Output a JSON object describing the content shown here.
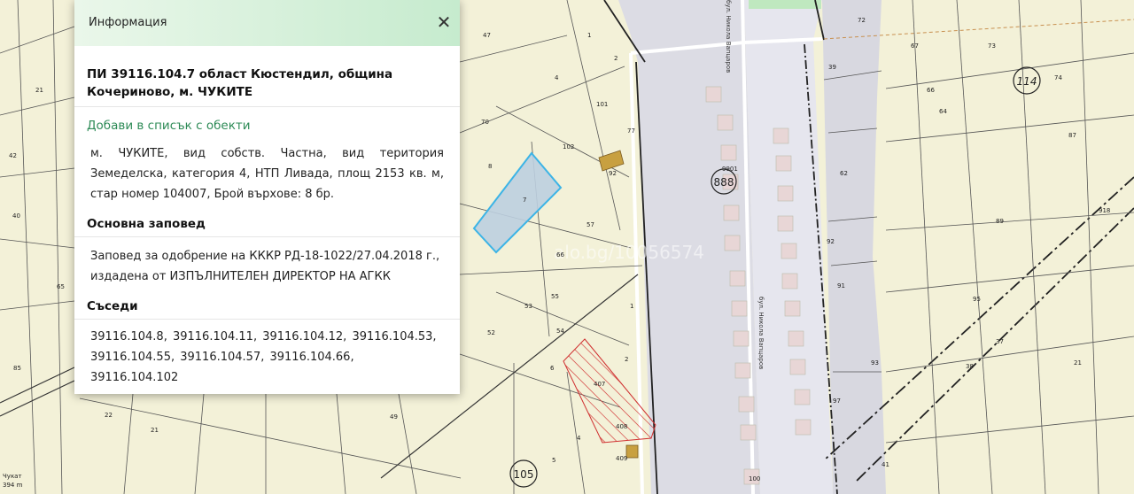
{
  "panel": {
    "title": "Информация",
    "close_symbol": "✕",
    "parcel_heading": "ПИ 39116.104.7 област Кюстендил, община Кочериново, м. ЧУКИТЕ",
    "add_link": "Добави в списък с обекти",
    "description": "м. ЧУКИТЕ, вид собств. Частна, вид територия Земеделска, категория 4, НТП Ливада, площ 2153 кв. м, стар номер 104007, Брой върхове: 8 бр.",
    "order_heading": "Основна заповед",
    "order_text_line1": "Заповед за одобрение на КККР РД-18-1022/27.04.2018 г.,",
    "order_text_line2": "издадена от ИЗПЪЛНИТЕЛЕН ДИРЕКТОР НА АГКК",
    "neighbors_heading": "Съседи",
    "neighbors_line1": "39116.104.8,  39116.104.11,  39116.104.12,  39116.104.53,",
    "neighbors_line2": "39116.104.55, 39116.104.57, 39116.104.66, 39116.104.102"
  },
  "map": {
    "watermark": "alo.bg/10056574",
    "street_name_1": "бул. Никола Вапцаров",
    "street_name_2": "бул. Никола Вапцаров",
    "circle_labels": [
      "888",
      "114",
      "105"
    ],
    "peak_label": "Чукат",
    "peak_elevation": "394 m",
    "plot_numbers": {
      "selected": "7",
      "p47": "47",
      "p1": "1",
      "p2": "2",
      "p4": "4",
      "p70": "70",
      "p101": "101",
      "p77": "77",
      "p102": "102",
      "p92": "92",
      "p8": "8",
      "p57": "57",
      "p66": "66",
      "p55": "55",
      "p53": "53",
      "p54": "54",
      "p52": "52",
      "p6": "6",
      "p407": "407",
      "p408": "408",
      "p409": "409",
      "p5": "5",
      "p22": "22",
      "p21": "21",
      "p49": "49",
      "p42": "42",
      "p40": "40",
      "p65": "65",
      "p85": "85",
      "p9901": "9901",
      "p39": "39",
      "p62": "62",
      "p91": "91",
      "p93": "93",
      "p97": "97",
      "p41": "41",
      "p72": "72",
      "p67": "67",
      "p73": "73",
      "p74": "74",
      "p66b": "66",
      "p64": "64",
      "p87": "87",
      "p89": "89",
      "p95": "95",
      "p37": "37",
      "p38": "38",
      "p21b": "21",
      "p919": "918",
      "p1r": "1",
      "p100": "100",
      "p105s": "105"
    },
    "colors": {
      "background": "#f3f1d8",
      "road": "#dcdce4",
      "selected_fill": "#bccfe0",
      "selected_stroke": "#3cb4e6",
      "hatch": "#d03030",
      "building": "#c8a040"
    }
  }
}
